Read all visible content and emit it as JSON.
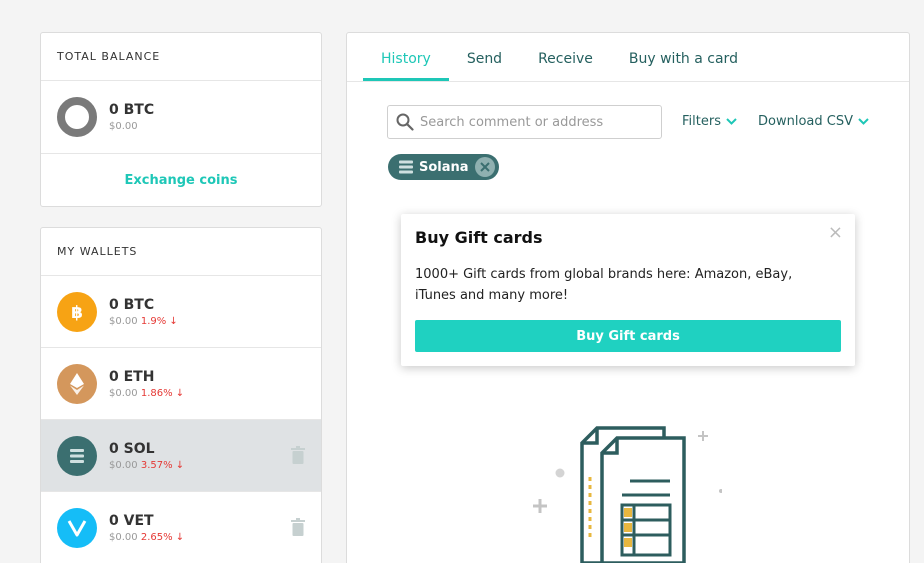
{
  "balance": {
    "header": "TOTAL BALANCE",
    "amount": "0 BTC",
    "fiat": "$0.00",
    "exchange_label": "Exchange coins"
  },
  "wallets": {
    "header": "MY WALLETS",
    "items": [
      {
        "amount": "0 BTC",
        "fiat": "$0.00",
        "change": "1.9% ↓",
        "icon": "bitcoin-icon",
        "color": "#f7a314"
      },
      {
        "amount": "0 ETH",
        "fiat": "$0.00",
        "change": "1.86% ↓",
        "icon": "ethereum-icon",
        "color": "#d4975c"
      },
      {
        "amount": "0 SOL",
        "fiat": "$0.00",
        "change": "3.57% ↓",
        "icon": "solana-icon",
        "color": "#3b6f70"
      },
      {
        "amount": "0 VET",
        "fiat": "$0.00",
        "change": "2.65% ↓",
        "icon": "vechain-icon",
        "color": "#15bdf7"
      }
    ]
  },
  "tabs": [
    "History",
    "Send",
    "Receive",
    "Buy with a card"
  ],
  "search": {
    "placeholder": "Search comment or address"
  },
  "filters_label": "Filters",
  "download_label": "Download CSV",
  "chip": {
    "label": "Solana"
  },
  "popup": {
    "title": "Buy Gift cards",
    "body": "1000+ Gift cards from global brands here: Amazon, eBay, iTunes and many more!",
    "button": "Buy Gift cards"
  },
  "colors": {
    "accent": "#1ec7b7",
    "teal_dark": "#3b6f70",
    "negative": "#e53935"
  }
}
